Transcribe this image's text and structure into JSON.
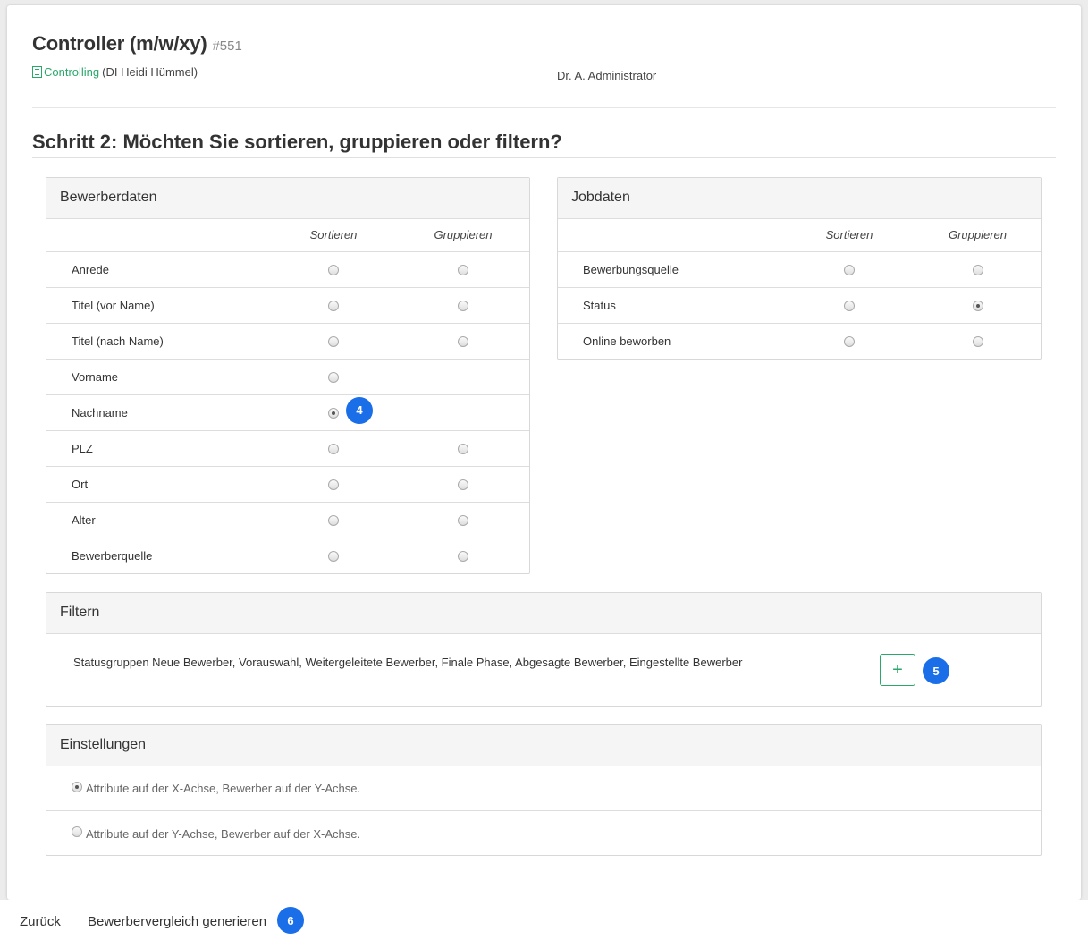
{
  "header": {
    "job_title": "Controller (m/w/xy)",
    "job_id": "#551",
    "department_link": "Controlling",
    "department_person": "(DI Heidi Hümmel)",
    "owner": "Dr. A. Administrator"
  },
  "step_title": "Schritt 2: Möchten Sie sortieren, gruppieren oder filtern?",
  "applicant_data": {
    "title": "Bewerberdaten",
    "col_sort": "Sortieren",
    "col_group": "Gruppieren",
    "rows": [
      {
        "label": "Anrede",
        "sort": false,
        "group": false
      },
      {
        "label": "Titel (vor Name)",
        "sort": false,
        "group": false
      },
      {
        "label": "Titel (nach Name)",
        "sort": false,
        "group": false
      },
      {
        "label": "Vorname",
        "sort": false,
        "group": null
      },
      {
        "label": "Nachname",
        "sort": true,
        "group": null
      },
      {
        "label": "PLZ",
        "sort": false,
        "group": false
      },
      {
        "label": "Ort",
        "sort": false,
        "group": false
      },
      {
        "label": "Alter",
        "sort": false,
        "group": false
      },
      {
        "label": "Bewerberquelle",
        "sort": false,
        "group": false
      }
    ]
  },
  "job_data": {
    "title": "Jobdaten",
    "col_sort": "Sortieren",
    "col_group": "Gruppieren",
    "rows": [
      {
        "label": "Bewerbungsquelle",
        "sort": false,
        "group": false
      },
      {
        "label": "Status",
        "sort": false,
        "group": true
      },
      {
        "label": "Online beworben",
        "sort": false,
        "group": false
      }
    ]
  },
  "filter": {
    "title": "Filtern",
    "text": "Statusgruppen Neue Bewerber, Vorauswahl, Weitergeleitete Bewerber, Finale Phase, Abgesagte Bewerber, Eingestellte Bewerber",
    "add_label": "+"
  },
  "settings": {
    "title": "Einstellungen",
    "options": [
      {
        "label": "Attribute auf der X-Achse, Bewerber auf der Y-Achse.",
        "selected": true
      },
      {
        "label": "Attribute auf der Y-Achse, Bewerber auf der X-Achse.",
        "selected": false
      }
    ]
  },
  "badges": {
    "b4": "4",
    "b5": "5",
    "b6": "6"
  },
  "footer": {
    "back_label": "Zurück",
    "generate_label": "Bewerbervergleich generieren"
  },
  "colors": {
    "accent_green": "#2aa86a",
    "badge_blue": "#1a6fe8"
  }
}
